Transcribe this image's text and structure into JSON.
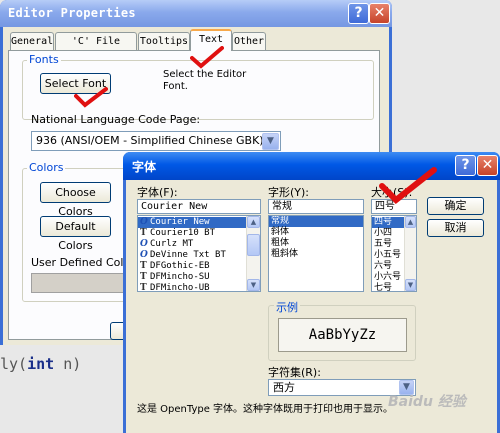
{
  "editor_window": {
    "title": "Editor Properties",
    "tabs": [
      "General",
      "'C' File Types",
      "Tooltips",
      "Text",
      "Other"
    ],
    "active_tab": "Text",
    "fonts_group": {
      "label": "Fonts",
      "select_font_button": "Select Font",
      "annotation": "Select the Editor Font."
    },
    "code_page": {
      "label": "National Language Code Page:",
      "value": "936  (ANSI/OEM - Simplified Chinese GBK)"
    },
    "colors_group": {
      "label": "Colors",
      "choose_colors_button": "Choose Colors",
      "default_colors_button": "Default Colors",
      "user_defined_label": "User Defined Color File"
    }
  },
  "code_snippet": {
    "prefix": "ly(",
    "keyword": "int",
    "suffix": " n)"
  },
  "font_dialog": {
    "title": "字体",
    "font_label": "字体(F):",
    "font_value": "Courier New",
    "fonts": [
      {
        "name": "Courier New",
        "icon": "O",
        "selected": true
      },
      {
        "name": "Courier10 BT",
        "icon": "T",
        "selected": false
      },
      {
        "name": "Curlz MT",
        "icon": "O",
        "selected": false
      },
      {
        "name": "DeVinne Txt BT",
        "icon": "O",
        "selected": false
      },
      {
        "name": "DFGothic-EB",
        "icon": "T",
        "selected": false
      },
      {
        "name": "DFMincho-SU",
        "icon": "T",
        "selected": false
      },
      {
        "name": "DFMincho-UB",
        "icon": "T",
        "selected": false
      }
    ],
    "style_label": "字形(Y):",
    "style_value": "常规",
    "styles": [
      {
        "name": "常规",
        "selected": true
      },
      {
        "name": "斜体",
        "selected": false
      },
      {
        "name": "粗体",
        "selected": false
      },
      {
        "name": "粗斜体",
        "selected": false
      }
    ],
    "size_label": "大小(S):",
    "size_value": "四号",
    "sizes": [
      {
        "name": "四号",
        "selected": true
      },
      {
        "name": "小四",
        "selected": false
      },
      {
        "name": "五号",
        "selected": false
      },
      {
        "name": "小五号",
        "selected": false
      },
      {
        "name": "六号",
        "selected": false
      },
      {
        "name": "小六号",
        "selected": false
      },
      {
        "name": "七号",
        "selected": false
      }
    ],
    "ok_button": "确定",
    "cancel_button": "取消",
    "sample_label": "示例",
    "sample_text": "AaBbYyZz",
    "charset_label": "字符集(R):",
    "charset_value": "西方",
    "info_text": "这是 OpenType 字体。这种字体既用于打印也用于显示。"
  },
  "watermark": "Baidu 经验",
  "colors": {
    "annotation_red": "#e01010",
    "selection_blue": "#316ac5",
    "group_label_blue": "#0046d5"
  }
}
